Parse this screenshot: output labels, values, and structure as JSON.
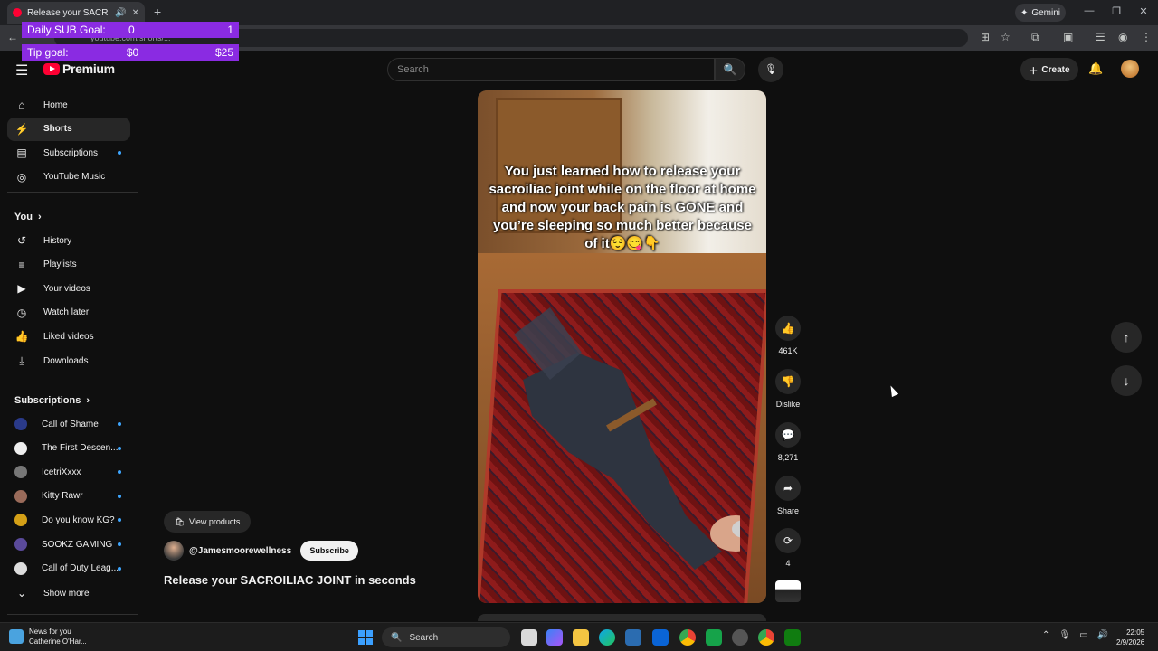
{
  "browser": {
    "tab_title": "Release your SACROILIAC J",
    "new_tab": "+",
    "gemini_label": "Gemini",
    "url": "youtube.com/shorts/...",
    "window_controls": [
      "—",
      "❐",
      "✕"
    ]
  },
  "goal_overlay": {
    "sub": {
      "label": "Daily SUB Goal:",
      "current": "0",
      "target": "1"
    },
    "tip": {
      "label": "Tip goal:",
      "current": "$0",
      "target": "$25"
    },
    "color": "#8a2be2"
  },
  "header": {
    "logo_text": "Premium",
    "search_placeholder": "Search",
    "create_label": "Create"
  },
  "sidebar": {
    "main": [
      {
        "label": "Home",
        "icon": "home-icon",
        "glyph": "⌂"
      },
      {
        "label": "Shorts",
        "icon": "shorts-icon",
        "glyph": "⚡",
        "active": true
      },
      {
        "label": "Subscriptions",
        "icon": "subscriptions-icon",
        "glyph": "▤",
        "dot": true
      },
      {
        "label": "YouTube Music",
        "icon": "music-icon",
        "glyph": "◎"
      }
    ],
    "you_title": "You",
    "you": [
      {
        "label": "History",
        "icon": "history-icon",
        "glyph": "↺"
      },
      {
        "label": "Playlists",
        "icon": "playlists-icon",
        "glyph": "≡"
      },
      {
        "label": "Your videos",
        "icon": "your-videos-icon",
        "glyph": "▶"
      },
      {
        "label": "Watch later",
        "icon": "watch-later-icon",
        "glyph": "◷"
      },
      {
        "label": "Liked videos",
        "icon": "liked-videos-icon",
        "glyph": "👍"
      },
      {
        "label": "Downloads",
        "icon": "downloads-icon",
        "glyph": "⤓"
      }
    ],
    "subs_title": "Subscriptions",
    "subs": [
      {
        "label": "Call of Shame",
        "color": "#2a3a8a"
      },
      {
        "label": "The First Descen...",
        "color": "#eeeeee"
      },
      {
        "label": "IcetriXxxx",
        "color": "#777777"
      },
      {
        "label": "Kitty Rawr",
        "color": "#9a6b5a"
      },
      {
        "label": "Do you know KG?",
        "color": "#d4a017"
      },
      {
        "label": "SOOKZ GAMING",
        "color": "#5a4a9a"
      },
      {
        "label": "Call of Duty Leag...",
        "color": "#dddddd"
      }
    ],
    "show_more": "Show more"
  },
  "short": {
    "caption": "You just learned how to release your sacroiliac joint while on the floor at home and now your back pain is GONE and you’re sleeping so much better because of it😌😋👇",
    "view_products": "View products",
    "channel": "@Jamesmoorewellness",
    "subscribe": "Subscribe",
    "title": "Release your SACROILIAC JOINT in seconds"
  },
  "actions": {
    "likes": "461K",
    "dislike": "Dislike",
    "comments": "8,271",
    "share": "Share",
    "remix": "4"
  },
  "taskbar": {
    "news_title": "News for you",
    "news_sub": "Catherine O'Har...",
    "search": "Search",
    "time": "22:05",
    "date": "2/9/2026"
  }
}
